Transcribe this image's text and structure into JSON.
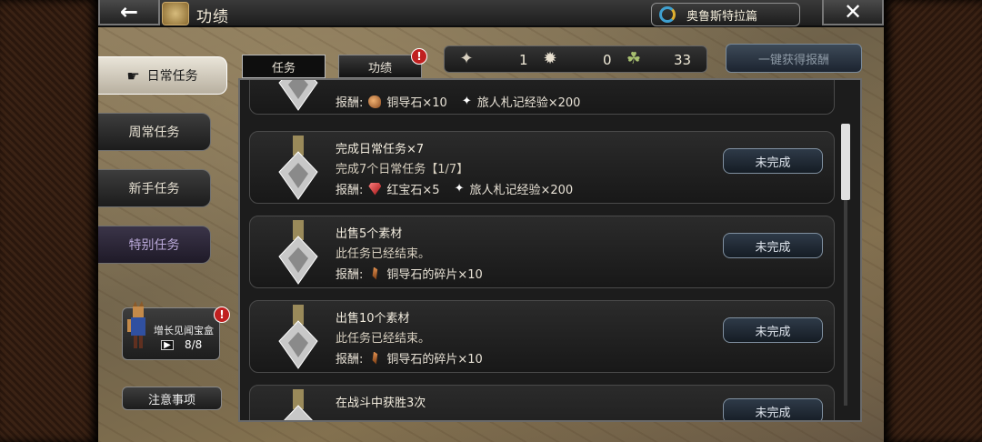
{
  "header": {
    "back_icon": "back-arrow-icon",
    "title": "功绩",
    "chapter_label": "奥鲁斯特拉篇",
    "close_icon": "close-icon"
  },
  "sidebar": {
    "items": [
      {
        "label": "日常任务",
        "active": true
      },
      {
        "label": "周常任务",
        "active": false
      },
      {
        "label": "新手任务",
        "active": false
      },
      {
        "label": "特别任务",
        "active": false
      }
    ],
    "reward_box": {
      "label": "增长见闻宝盒",
      "count": "8/8",
      "alert": "!"
    },
    "notice_label": "注意事项"
  },
  "tabs": [
    {
      "label": "任务",
      "active": true
    },
    {
      "label": "功绩",
      "active": false,
      "alert": "!"
    }
  ],
  "currency": [
    {
      "icon": "silver-compass-icon",
      "value": "1"
    },
    {
      "icon": "medal-icon",
      "value": "0"
    },
    {
      "icon": "leaf-icon",
      "value": "33"
    }
  ],
  "claim_all_label": "一键获得报酬",
  "tasks": [
    {
      "name": "",
      "desc": "",
      "reward_prefix": "报酬:",
      "reward1": "铜导石×10",
      "reward2": "旅人札记经验×200",
      "status": ""
    },
    {
      "name": "完成日常任务×7",
      "desc": "完成7个日常任务【1/7】",
      "reward_prefix": "报酬:",
      "reward1": "红宝石×5",
      "reward2": "旅人札记经验×200",
      "status": "未完成"
    },
    {
      "name": "出售5个素材",
      "desc": "此任务已经结束。",
      "reward_prefix": "报酬:",
      "reward1": "铜导石的碎片×10",
      "status": "未完成"
    },
    {
      "name": "出售10个素材",
      "desc": "此任务已经结束。",
      "reward_prefix": "报酬:",
      "reward1": "铜导石的碎片×10",
      "status": "未完成"
    },
    {
      "name": "在战斗中获胜3次",
      "status": "未完成"
    }
  ],
  "colors": {
    "accent_alert": "#c02020",
    "status_button": "#2e3a48",
    "panel_bg": "#1c1c1c"
  }
}
